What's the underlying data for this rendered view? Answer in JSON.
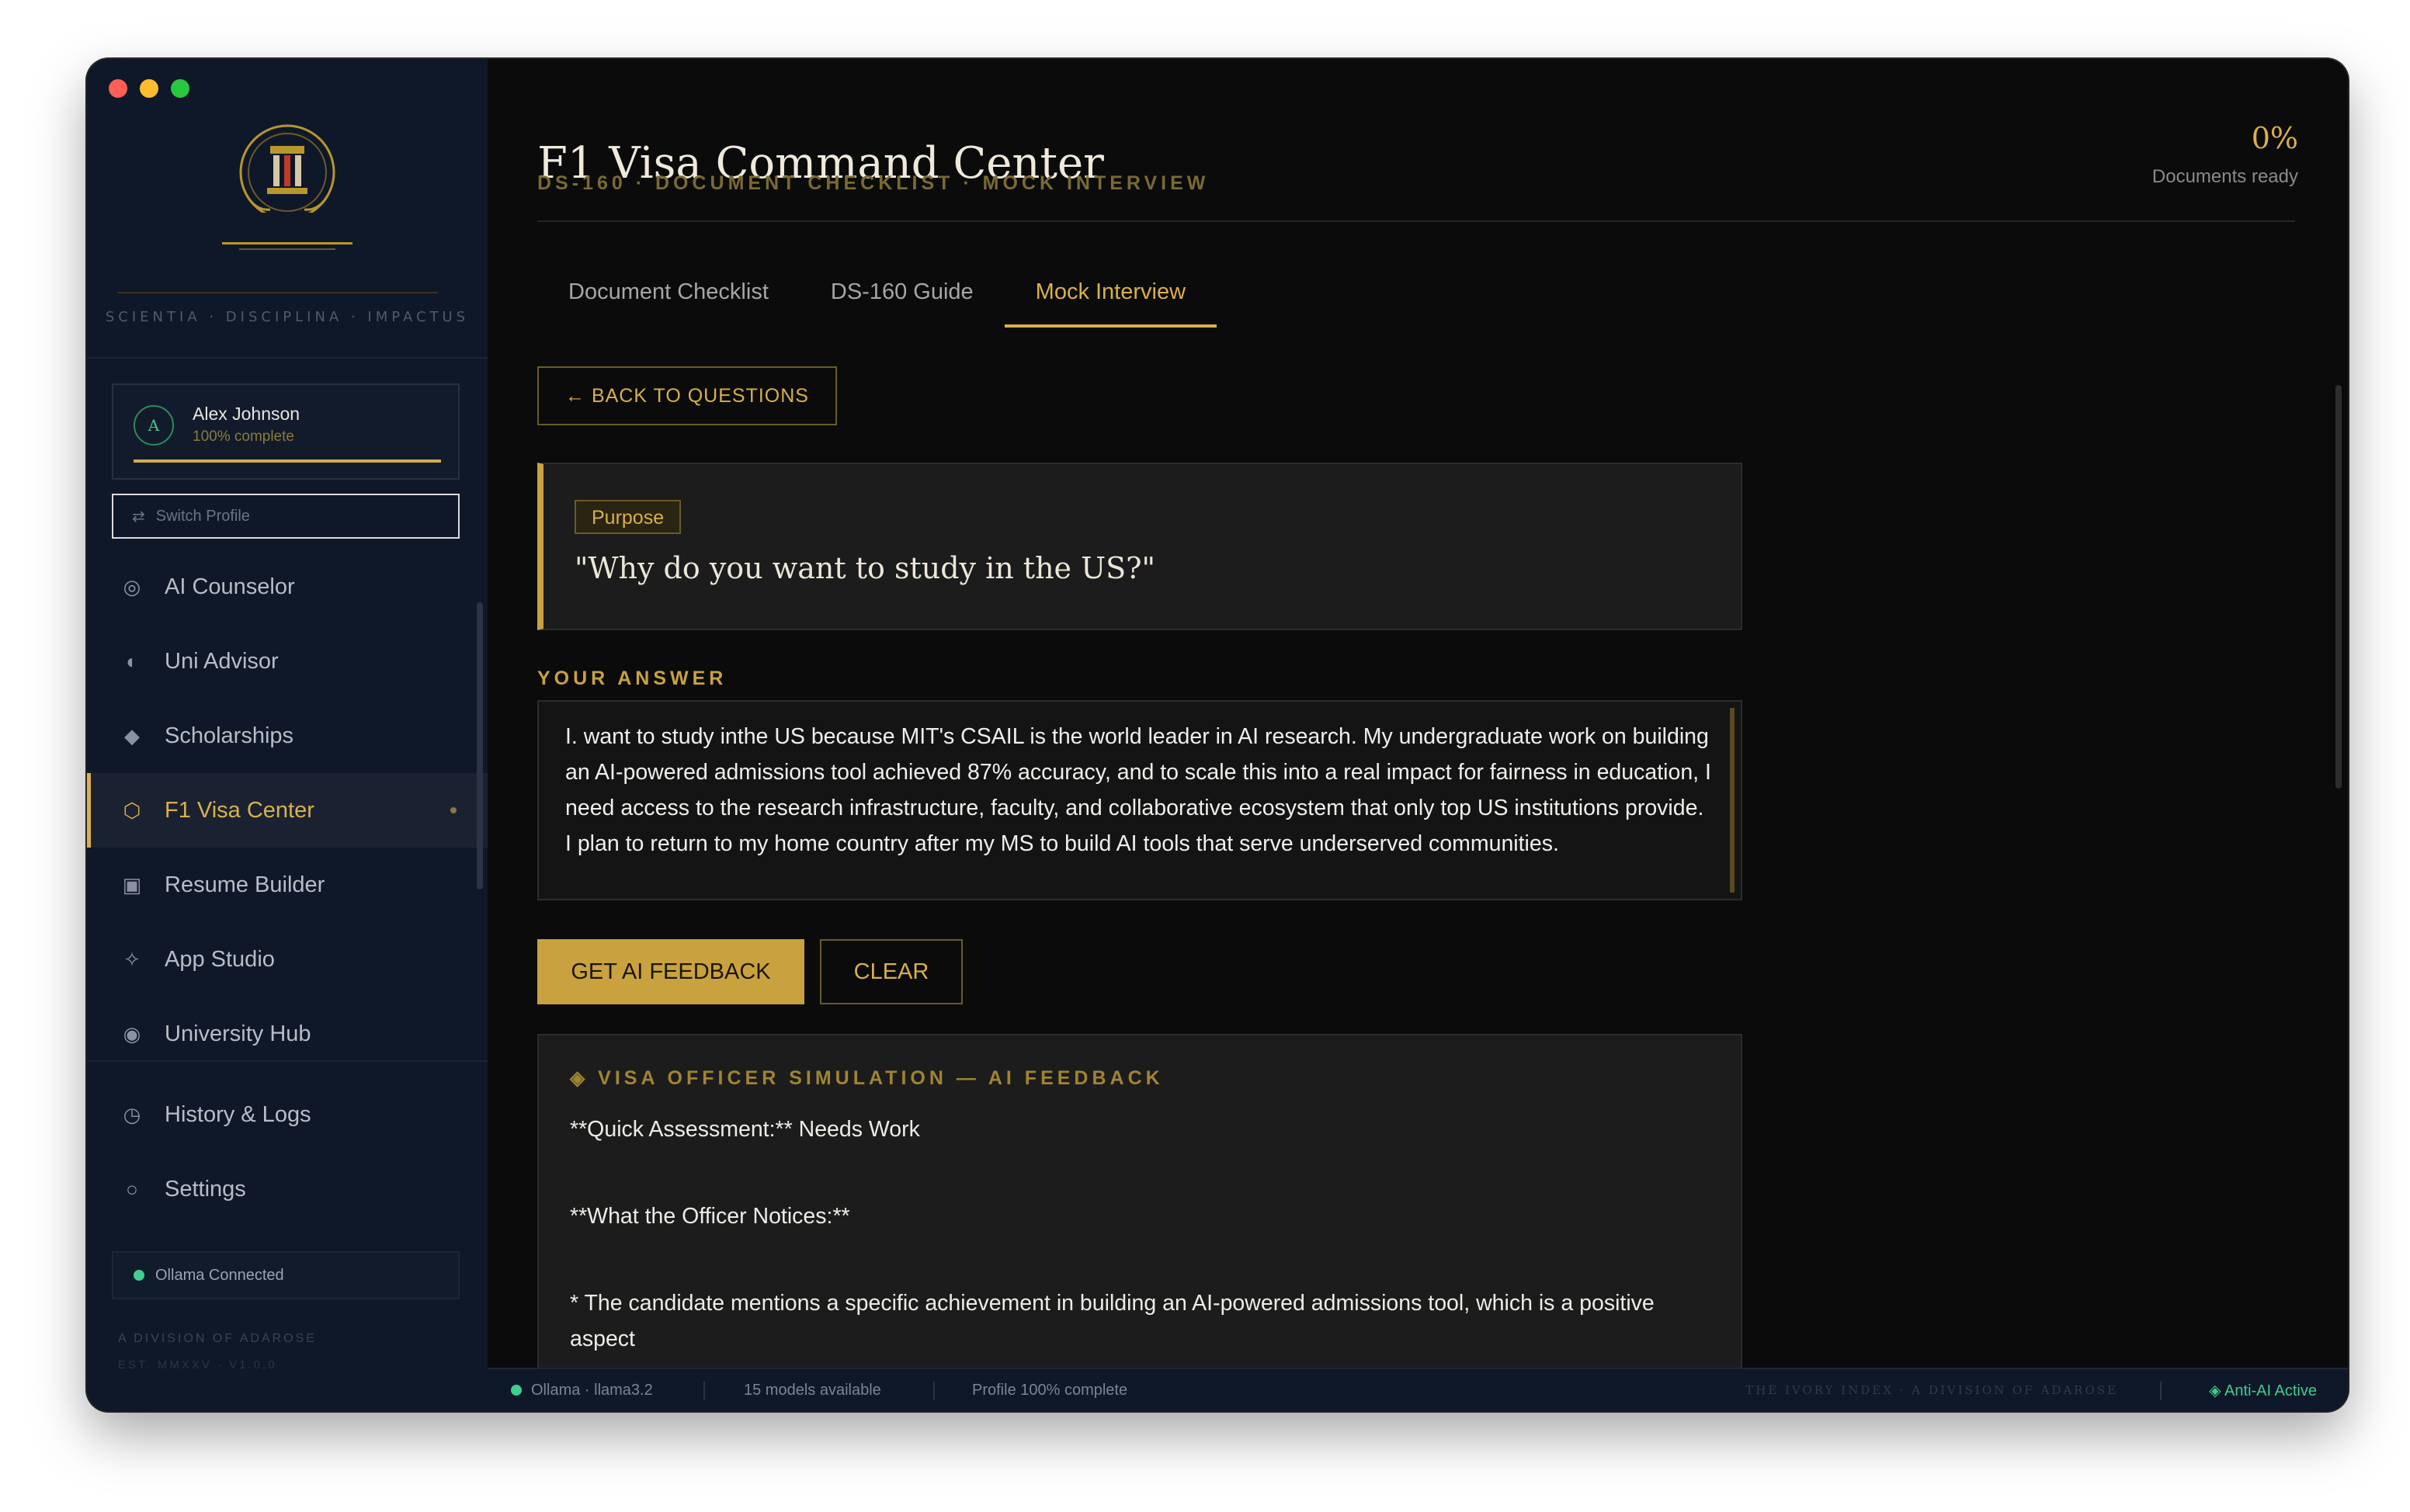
{
  "sidebar": {
    "motto": "SCIENTIA · DISCIPLINA · IMPACTUS",
    "profile": {
      "initial": "A",
      "name": "Alex Johnson",
      "completion_label": "100% complete",
      "completion": 1.0
    },
    "switch_profile": "Switch Profile",
    "nav": [
      {
        "label": "AI Counselor",
        "icon": "target-icon"
      },
      {
        "label": "Uni Advisor",
        "icon": "half-circle-icon"
      },
      {
        "label": "Scholarships",
        "icon": "diamond-icon"
      },
      {
        "label": "F1 Visa Center",
        "icon": "hexagon-icon",
        "active": true
      },
      {
        "label": "Resume Builder",
        "icon": "square-icon"
      },
      {
        "label": "App Studio",
        "icon": "sparkle-icon"
      },
      {
        "label": "University Hub",
        "icon": "radio-icon"
      }
    ],
    "nav_secondary": [
      {
        "label": "History & Logs",
        "icon": "clock-icon"
      },
      {
        "label": "Settings",
        "icon": "circle-icon"
      }
    ],
    "ollama_status": "Ollama Connected",
    "division": "A DIVISION OF ADAROSE",
    "version": "EST. MMXXV · V1.0.0"
  },
  "header": {
    "title": "F1 Visa Command Center",
    "subtitle": "DS-160 · DOCUMENT CHECKLIST · MOCK INTERVIEW",
    "percent": "0%",
    "percent_label": "Documents ready"
  },
  "tabs": [
    {
      "label": "Document Checklist"
    },
    {
      "label": "DS-160 Guide"
    },
    {
      "label": "Mock Interview",
      "active": true
    }
  ],
  "interview": {
    "back_label": "← BACK TO QUESTIONS",
    "category": "Purpose",
    "question": "\"Why do you want to study in the US?\"",
    "answer_label": "YOUR ANSWER",
    "answer": "I. want to study inthe US because MIT's CSAIL is the world leader in AI research. My undergraduate work on building an AI-powered admissions tool achieved 87% accuracy, and to scale this into a real impact for fairness in education, I need access to the research infrastructure, faculty, and collaborative ecosystem that only top US institutions provide. I plan to return to my home country after my MS to build AI tools that serve underserved communities.",
    "feedback_button": "GET AI FEEDBACK",
    "clear_button": "CLEAR"
  },
  "feedback": {
    "heading": "◈ VISA OFFICER SIMULATION — AI FEEDBACK",
    "lines": [
      "**Quick Assessment:** Needs Work",
      "**What the Officer Notices:**",
      "* The candidate mentions a specific achievement in building an AI-powered admissions tool, which is a positive aspect"
    ]
  },
  "statusbar": {
    "model": "Ollama · llama3.2",
    "models": "15 models available",
    "profile": "Profile 100% complete",
    "brand": "THE IVORY INDEX · A DIVISION OF ADAROSE",
    "anti_ai": "◈ Anti-AI Active"
  },
  "colors": {
    "accent": "#d9b04a",
    "sidebar_bg": "#0f1828",
    "main_bg": "#0b0b0b",
    "status_green": "#3ecf8e"
  }
}
